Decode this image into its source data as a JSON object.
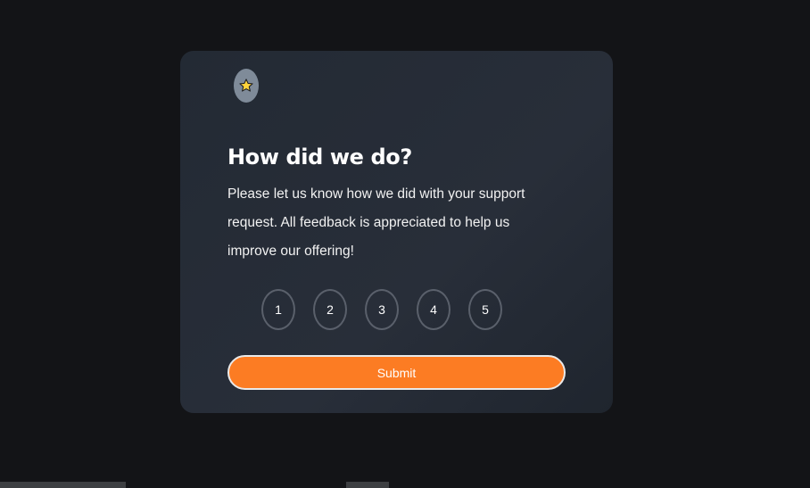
{
  "card": {
    "icon": "star-icon",
    "title": "How did we do?",
    "description": "Please let us know how we did with your support request. All feedback is appreciated to help us improve our offering!",
    "ratings": [
      "1",
      "2",
      "3",
      "4",
      "5"
    ],
    "submit_label": "Submit"
  },
  "colors": {
    "page_background": "#131417",
    "card_background": "#252d37",
    "accent": "#fc7c23",
    "star_badge": "#7f8b99",
    "star": "#ffd43b"
  }
}
